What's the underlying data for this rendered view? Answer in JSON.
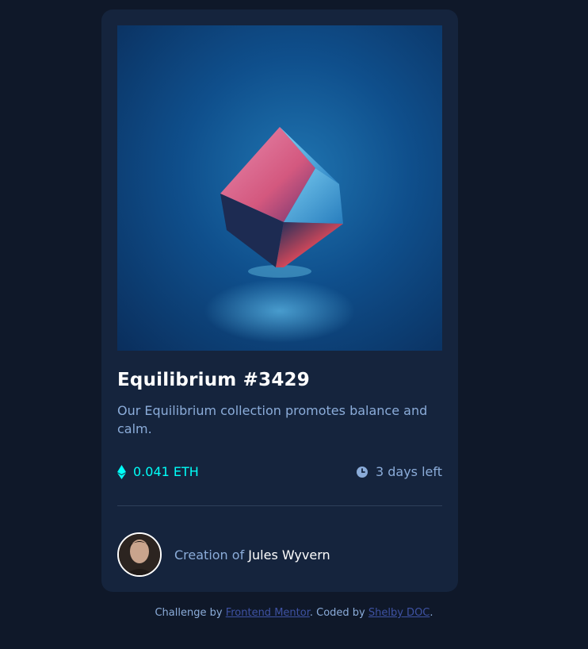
{
  "card": {
    "title": "Equilibrium #3429",
    "description": "Our Equilibrium collection promotes balance and calm.",
    "price": "0.041 ETH",
    "time_left": "3 days left",
    "creator_prefix": "Creation of",
    "creator_name": "Jules Wyvern"
  },
  "footer": {
    "prefix": "Challenge by",
    "link1": "Frontend Mentor",
    "middle": ". Coded by",
    "link2": "Shelby DOC",
    "suffix": "."
  },
  "colors": {
    "page_bg": "#0f1829",
    "card_bg": "#15243d",
    "accent_cyan": "#00fff8",
    "soft_blue": "#8bacd9",
    "link_blue": "#3e52a3"
  },
  "icons": {
    "price": "ethereum-icon",
    "time": "clock-icon"
  }
}
